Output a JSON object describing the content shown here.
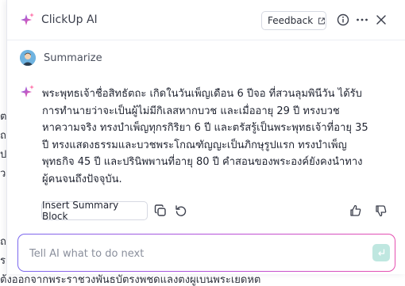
{
  "header": {
    "title": "ClickUp AI",
    "feedback_label": "Feedback"
  },
  "prompt": {
    "label": "Summarize"
  },
  "response": {
    "lines": [
      "พระพุทธเจ้าชื่อสิทธัตถะ เกิดในวันเพ็ญเดือน 6 ปีจอ ที่สวนลุมพินีวัน ได้รับ",
      "การทำนายว่าจะเป็นผู้ไม่มีกิเลสหากบวช และเมื่ออายุ 29 ปี ทรงบวช",
      "หาความจริง ทรงบำเพ็ญทุกรกิริยา 6 ปี และตรัสรู้เป็นพระพุทธเจ้าที่อายุ 35",
      "ปี ทรงแสดงธรรมและบวชพระโกณฑัญญะเป็นภิกษุรูปแรก ทรงบำเพ็ญ",
      "พุทธกิจ 45 ปี และปรินิพพานที่อายุ 80 ปี คำสอนของพระองค์ยังคงนำทาง",
      "ผู้คนจนถึงปัจจุบัน."
    ]
  },
  "actions": {
    "insert_label": "Insert Summary Block"
  },
  "input": {
    "placeholder": "Tell AI what to do next"
  },
  "background": {
    "bottom_text": "ต้งออกจากพระราชวงพันธบัตรงพชดแลงตงผูเบนพระเยดหต"
  },
  "colors": {
    "accent_gradient": [
      "#7b68ee",
      "#e64fb0"
    ],
    "send_button": "#bfe7e0"
  }
}
